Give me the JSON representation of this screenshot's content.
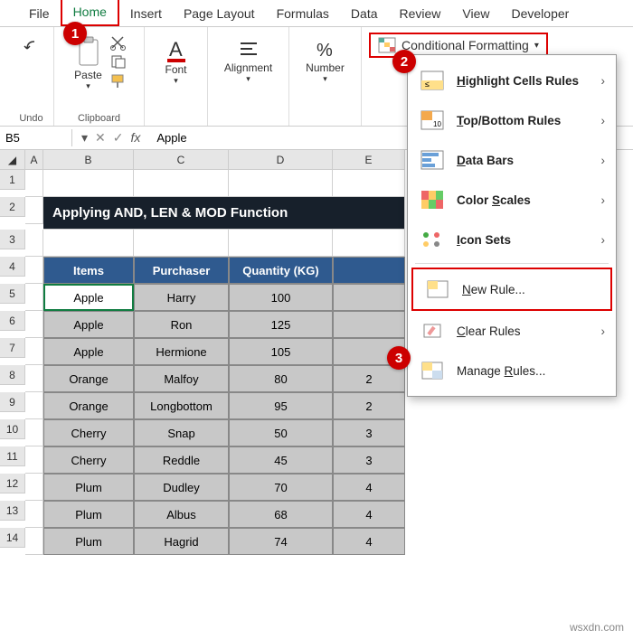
{
  "menu": {
    "tabs": [
      "File",
      "Home",
      "Insert",
      "Page Layout",
      "Formulas",
      "Data",
      "Review",
      "View",
      "Developer"
    ],
    "active": "Home"
  },
  "ribbon": {
    "undo_label": "Undo",
    "clipboard_label": "Clipboard",
    "paste_label": "Paste",
    "font_label": "Font",
    "alignment_label": "Alignment",
    "number_label": "Number",
    "cf_label": "Conditional Formatting"
  },
  "namebox": "B5",
  "formula": "Apple",
  "columns": [
    "A",
    "B",
    "C",
    "D",
    "E"
  ],
  "title_bar": "Applying AND, LEN & MOD Function",
  "headers": [
    "Items",
    "Purchaser",
    "Quantity (KG)",
    ""
  ],
  "rows": [
    [
      "Apple",
      "Harry",
      "100",
      ""
    ],
    [
      "Apple",
      "Ron",
      "125",
      ""
    ],
    [
      "Apple",
      "Hermione",
      "105",
      ""
    ],
    [
      "Orange",
      "Malfoy",
      "80",
      "2"
    ],
    [
      "Orange",
      "Longbottom",
      "95",
      "2"
    ],
    [
      "Cherry",
      "Snap",
      "50",
      "3"
    ],
    [
      "Cherry",
      "Reddle",
      "45",
      "3"
    ],
    [
      "Plum",
      "Dudley",
      "70",
      "4"
    ],
    [
      "Plum",
      "Albus",
      "68",
      "4"
    ],
    [
      "Plum",
      "Hagrid",
      "74",
      "4"
    ]
  ],
  "row_numbers": [
    "1",
    "2",
    "3",
    "4",
    "5",
    "6",
    "7",
    "8",
    "9",
    "10",
    "11",
    "12",
    "13",
    "14"
  ],
  "dropdown": {
    "highlight": "Highlight Cells Rules",
    "topbottom": "Top/Bottom Rules",
    "databars": "Data Bars",
    "colorscales": "Color Scales",
    "iconsets": "Icon Sets",
    "newrule": "New Rule...",
    "clearrules": "Clear Rules",
    "managerules": "Manage Rules..."
  },
  "markers": {
    "m1": "1",
    "m2": "2",
    "m3": "3"
  },
  "watermark": "wsxdn.com"
}
